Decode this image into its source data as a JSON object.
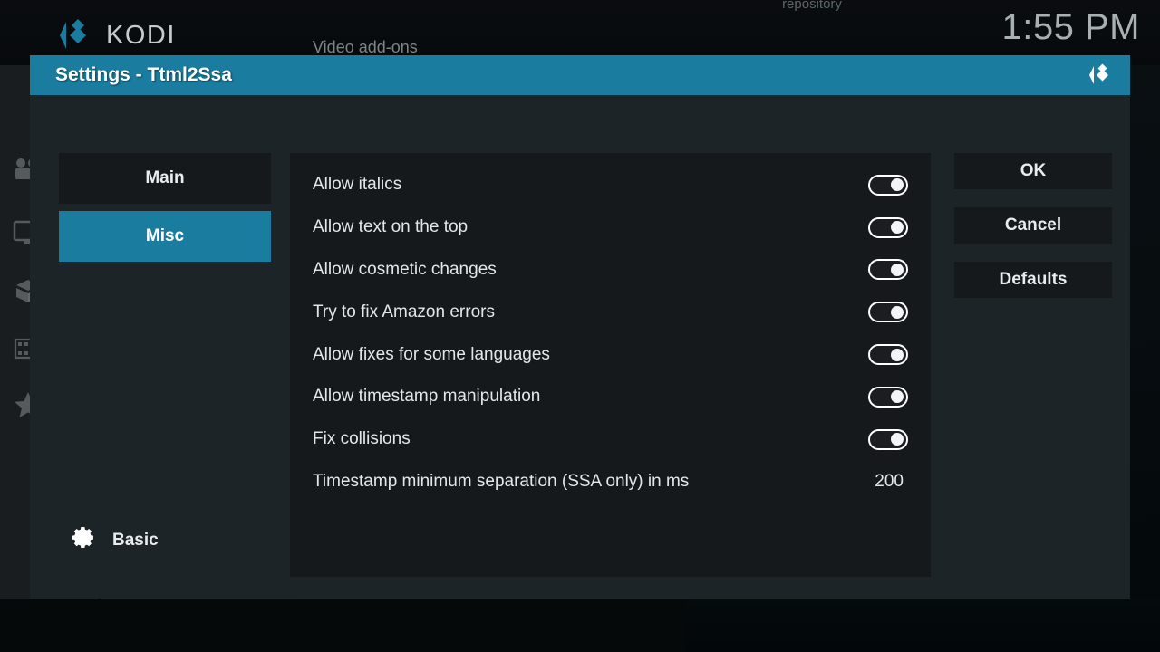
{
  "app": {
    "brand_name": "KODI",
    "clock": "1:55 PM",
    "accent_color": "#1a7d9f",
    "panel_color": "#15191b",
    "dialog_color": "#1c2427"
  },
  "background": {
    "section_label": "Video add-ons",
    "tiles": [
      {
        "label": ""
      },
      {
        "label": ""
      },
      {
        "label": "repository"
      }
    ],
    "sidebar_icons": [
      "movie-camera-icon",
      "monitor-icon",
      "box-icon",
      "film-strip-icon",
      "star-icon"
    ]
  },
  "dialog": {
    "title": "Settings - Ttml2Ssa",
    "header_logo": "kodi-logo-icon",
    "nav": {
      "items": [
        {
          "label": "Main",
          "selected": false
        },
        {
          "label": "Misc",
          "selected": true
        }
      ],
      "level": {
        "icon": "gear-icon",
        "label": "Basic"
      }
    },
    "settings": [
      {
        "label": "Allow italics",
        "type": "toggle",
        "value": "on"
      },
      {
        "label": "Allow text on the top",
        "type": "toggle",
        "value": "on"
      },
      {
        "label": "Allow cosmetic changes",
        "type": "toggle",
        "value": "on"
      },
      {
        "label": "Try to fix Amazon errors",
        "type": "toggle",
        "value": "on"
      },
      {
        "label": "Allow fixes for some languages",
        "type": "toggle",
        "value": "on"
      },
      {
        "label": "Allow timestamp manipulation",
        "type": "toggle",
        "value": "on"
      },
      {
        "label": "Fix collisions",
        "type": "toggle",
        "value": "on"
      },
      {
        "label": "Timestamp minimum separation (SSA only) in ms",
        "type": "value",
        "value": "200"
      }
    ],
    "actions": [
      {
        "label": "OK"
      },
      {
        "label": "Cancel"
      },
      {
        "label": "Defaults"
      }
    ]
  }
}
